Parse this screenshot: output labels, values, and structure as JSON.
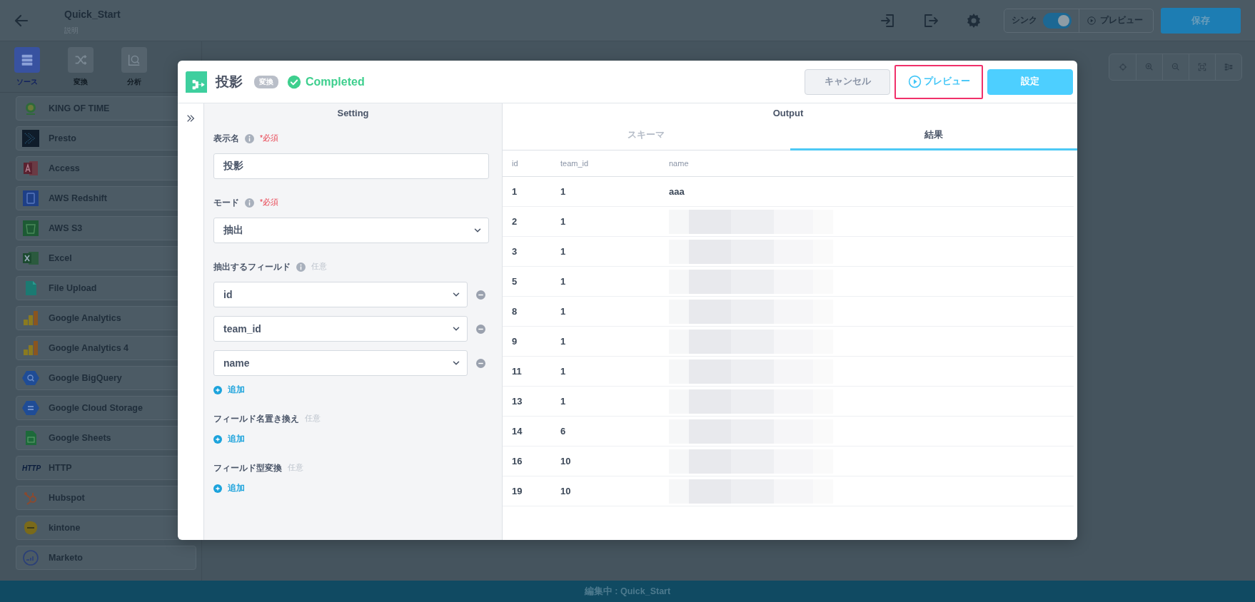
{
  "topbar": {
    "title": "Quick_Start",
    "subtitle": "説明",
    "sync": {
      "label": "シンク",
      "on": true
    },
    "preview_label": "プレビュー",
    "save_label": "保存"
  },
  "nav_tabs": [
    {
      "label": "ソース",
      "selected": true
    },
    {
      "label": "変換",
      "selected": false
    },
    {
      "label": "分析",
      "selected": false
    }
  ],
  "sources": [
    {
      "label": "KING OF TIME"
    },
    {
      "label": "Presto"
    },
    {
      "label": "Access"
    },
    {
      "label": "AWS Redshift"
    },
    {
      "label": "AWS S3"
    },
    {
      "label": "Excel"
    },
    {
      "label": "File Upload"
    },
    {
      "label": "Google Analytics"
    },
    {
      "label": "Google Analytics 4"
    },
    {
      "label": "Google BigQuery"
    },
    {
      "label": "Google Cloud Storage"
    },
    {
      "label": "Google Sheets"
    },
    {
      "label": "HTTP",
      "logo_text": "HTTP"
    },
    {
      "label": "Hubspot"
    },
    {
      "label": "kintone"
    },
    {
      "label": "Marketo"
    }
  ],
  "modal": {
    "title": "投影",
    "badge": "変換",
    "status": "Completed",
    "buttons": [
      {
        "kind": "cancel",
        "label": "キャンセル",
        "highlighted": false
      },
      {
        "kind": "preview",
        "label": "プレビュー",
        "highlighted": true
      },
      {
        "kind": "confirm",
        "label": "設定",
        "highlighted": false
      }
    ]
  },
  "settings": {
    "heading": "Setting",
    "fields": [
      {
        "kind": "text",
        "label": "表示名",
        "info": true,
        "requirement": "*必須",
        "required": true,
        "value": "投影"
      },
      {
        "kind": "select",
        "label": "モード",
        "info": true,
        "requirement": "*必須",
        "required": true,
        "value": "抽出"
      },
      {
        "kind": "select-list",
        "label": "抽出するフィールド",
        "info": true,
        "requirement": "任意",
        "required": false,
        "values": [
          "id",
          "team_id",
          "name"
        ],
        "add_label": "追加"
      },
      {
        "kind": "add",
        "label": "フィールド名置き換え",
        "info": false,
        "requirement": "任意",
        "required": false,
        "add_label": "追加"
      },
      {
        "kind": "add",
        "label": "フィールド型変換",
        "info": false,
        "requirement": "任意",
        "required": false,
        "add_label": "追加"
      }
    ]
  },
  "output": {
    "heading": "Output",
    "tabs": [
      {
        "label": "スキーマ",
        "selected": false
      },
      {
        "label": "結果",
        "selected": true
      }
    ],
    "columns": [
      "id",
      "team_id",
      "name"
    ],
    "rows": [
      {
        "cells": [
          "1",
          "1",
          "aaa"
        ],
        "redacted": false
      },
      {
        "cells": [
          "2",
          "1"
        ],
        "redacted": true
      },
      {
        "cells": [
          "3",
          "1"
        ],
        "redacted": true
      },
      {
        "cells": [
          "5",
          "1"
        ],
        "redacted": true
      },
      {
        "cells": [
          "8",
          "1"
        ],
        "redacted": true
      },
      {
        "cells": [
          "9",
          "1"
        ],
        "redacted": true
      },
      {
        "cells": [
          "11",
          "1"
        ],
        "redacted": true
      },
      {
        "cells": [
          "13",
          "1"
        ],
        "redacted": true
      },
      {
        "cells": [
          "14",
          "6"
        ],
        "redacted": true
      },
      {
        "cells": [
          "16",
          "10"
        ],
        "redacted": true
      },
      {
        "cells": [
          "19",
          "10"
        ],
        "redacted": true
      }
    ]
  },
  "status_bar": "編集中 : Quick_Start"
}
